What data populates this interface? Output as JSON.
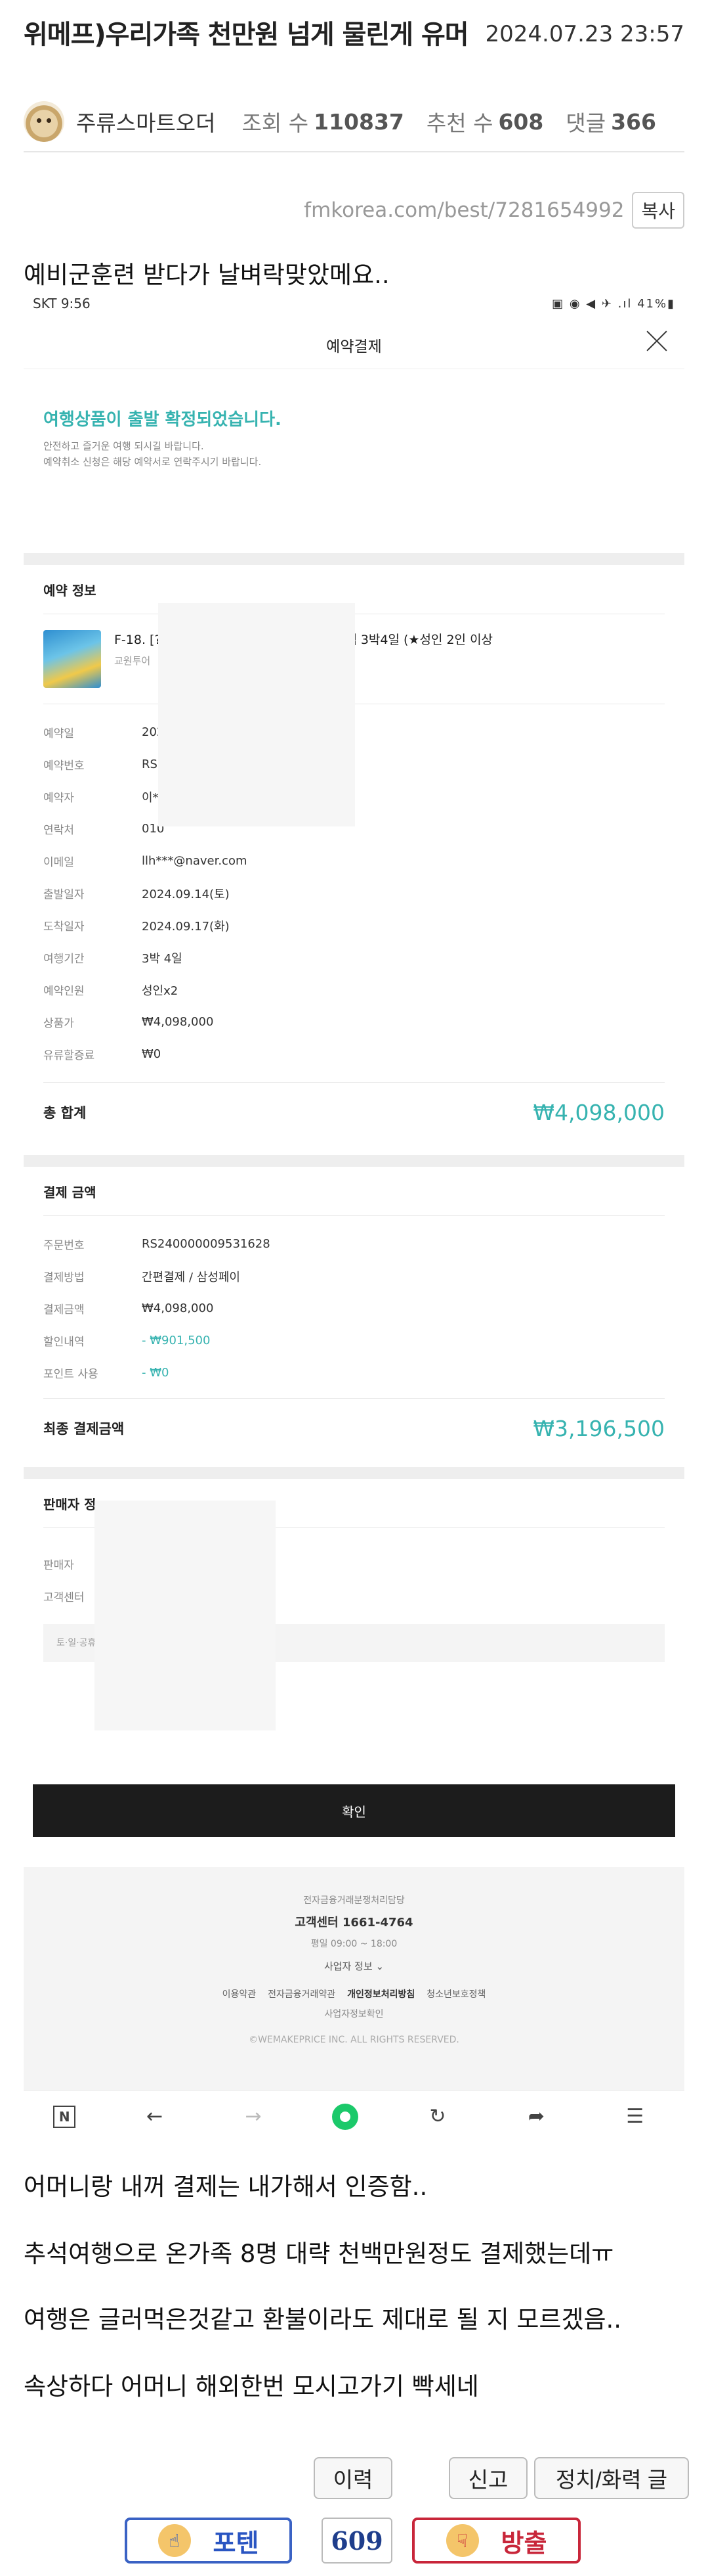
{
  "post": {
    "title": "위메프)우리가족 천만원 넘게 물린게 유머",
    "date": "2024.07.23 23:57",
    "author": "주류스마트오더",
    "views_label": "조회 수",
    "views": "110837",
    "likes_label": "추천 수",
    "likes": "608",
    "comments_label": "댓글",
    "comments": "366",
    "url": "fmkorea.com/best/7281654992",
    "copy_label": "복사",
    "intro": "예비군훈련 받다가 날벼락맞았메요..",
    "paragraphs": [
      "어머니랑 내꺼 결제는 내가해서 인증함..",
      "추석여행으로 온가족 8명 대략 천백만원정도 결제했는데ㅠ",
      "여행은 글러먹은것같고 환불이라도 제대로 될 지 모르겠음..",
      "속상하다 어머니 해외한번 모시고가기 빡세네"
    ]
  },
  "screenshot": {
    "status_left": "SKT 9:56",
    "status_right": "▣ ◉ ◀ ✈ .ıl 41%▮",
    "page_title": "예약결제",
    "confirm_title": "여행상품이 출발 확정되었습니다.",
    "confirm_sub1": "안전하고 즐거운 여행 되시길 바랍니다.",
    "confirm_sub2": "예약취소 신청은 해당 예약서로 연락주시기 바랍니다.",
    "reservation_section": "예약 정보",
    "product_name": "F-18. [?                                   ?C 리조트 프리미엄 골드카드 일반팩 3박4일 (★성인 2인 이상",
    "product_seller": "교원투어",
    "reservation_rows": [
      {
        "k": "예약일",
        "v": "202"
      },
      {
        "k": "예약번호",
        "v": "RS"
      },
      {
        "k": "예약자",
        "v": "이*"
      },
      {
        "k": "연락처",
        "v": "010"
      },
      {
        "k": "이메일",
        "v": "llh***@naver.com"
      },
      {
        "k": "출발일자",
        "v": "2024.09.14(토)"
      },
      {
        "k": "도착일자",
        "v": "2024.09.17(화)"
      },
      {
        "k": "여행기간",
        "v": "3박 4일"
      },
      {
        "k": "예약인원",
        "v": "성인x2"
      },
      {
        "k": "상품가",
        "v": "₩4,098,000"
      },
      {
        "k": "유류할증료",
        "v": "₩0"
      }
    ],
    "total_label": "총 합계",
    "total_value": "₩4,098,000",
    "payment_section": "결제 금액",
    "payment_rows": [
      {
        "k": "주문번호",
        "v": "RS240000009531628"
      },
      {
        "k": "결제방법",
        "v": "간편결제 / 삼성페이"
      },
      {
        "k": "결제금액",
        "v": "₩4,098,000"
      },
      {
        "k": "할인내역",
        "v": "- ₩901,500"
      },
      {
        "k": "포인트 사용",
        "v": "- ₩0"
      }
    ],
    "final_label": "최종 결제금액",
    "final_value": "₩3,196,500",
    "seller_section": "판매자 정",
    "seller_rows": [
      {
        "k": "판매자",
        "v": ""
      },
      {
        "k": "고객센터",
        "v": ""
      }
    ],
    "notice": "토·일·공휴일은 상담이 불가합니다",
    "confirm_button": "확인",
    "footer": {
      "line1": "전자금융거래분쟁처리담당",
      "line2": "고객센터 1661-4764",
      "line3": "평일 09:00 ~ 18:00",
      "line4": "사업자 정보 ⌄",
      "links": [
        "이용약관",
        "전자금융거래약관",
        "개인정보처리방침",
        "청소년보호정책"
      ],
      "line5": "사업자정보확인",
      "copyright": "©WEMAKEPRICE INC. ALL RIGHTS RESERVED."
    }
  },
  "actions": {
    "history": "이력",
    "report": "신고",
    "politics": "정치/화력 글",
    "vote_up": "포텐",
    "vote_count": "609",
    "vote_down": "방출"
  },
  "colors": {
    "teal": "#36b3b0",
    "vote_up": "#2a55c2",
    "vote_down": "#c8263a"
  }
}
